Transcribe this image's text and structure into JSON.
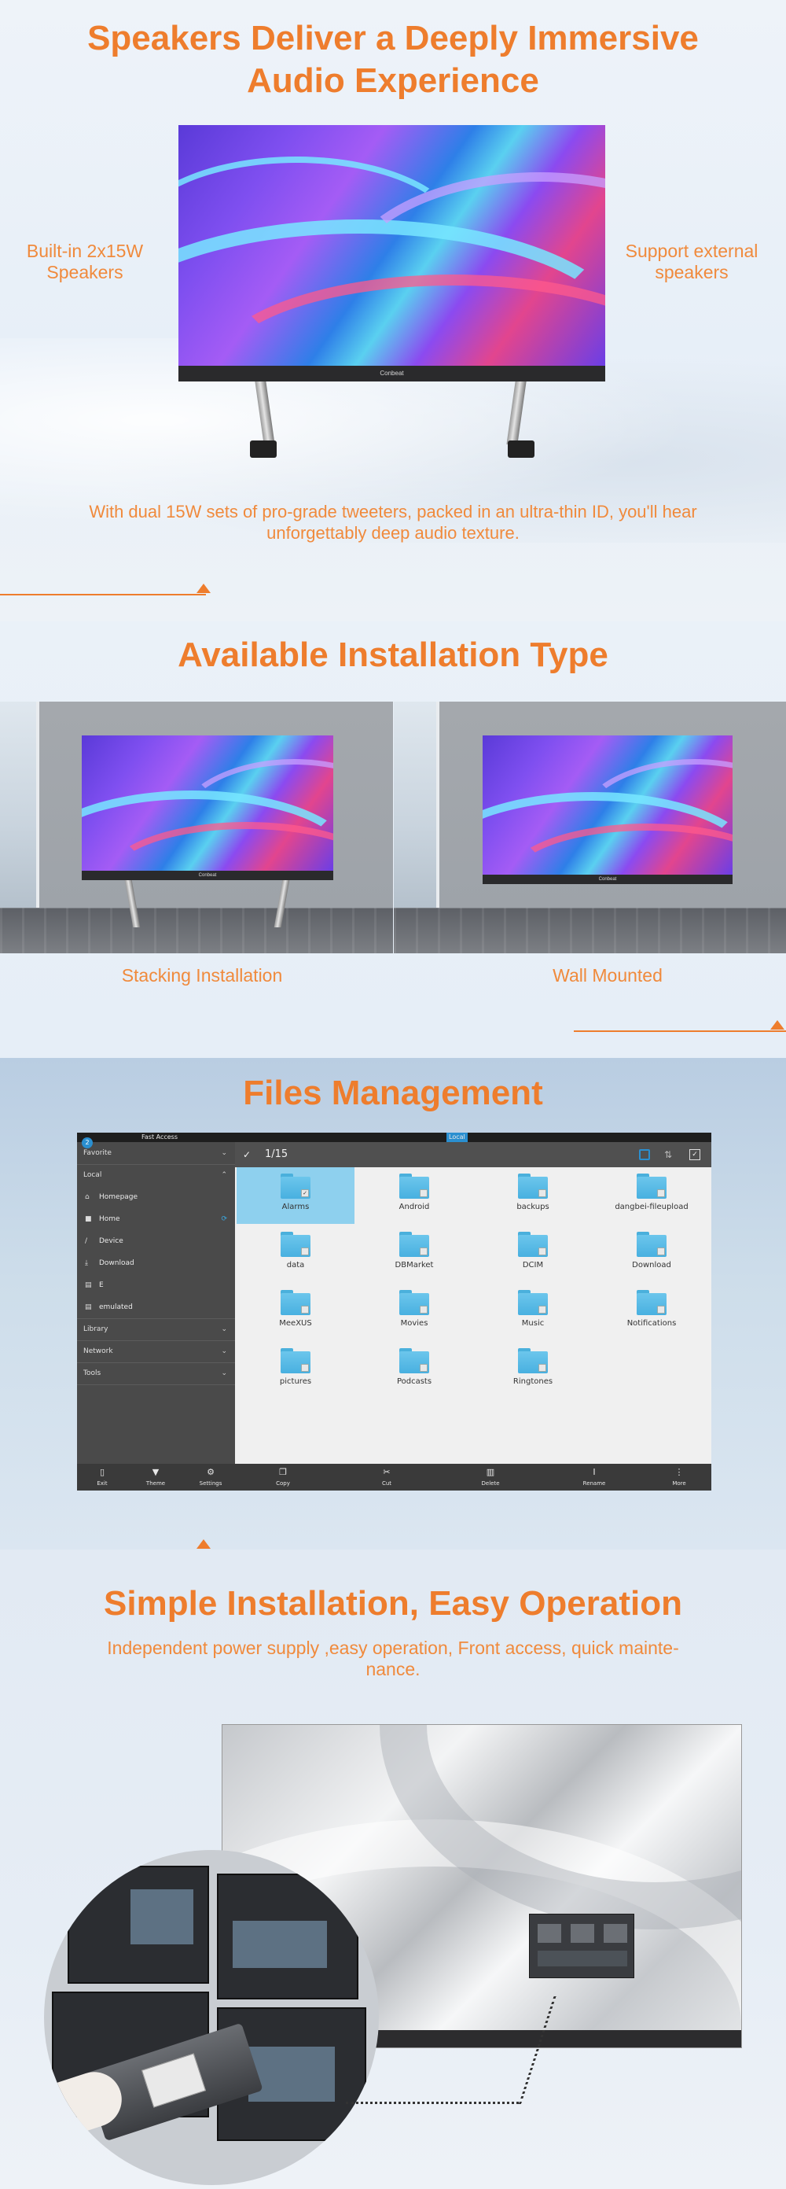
{
  "section_audio": {
    "title_line1": "Speakers Deliver a Deeply Immersive",
    "title_line2": "Audio Experience",
    "left_label": "Built-in 2x15W Speakers",
    "right_label": "Support external speakers",
    "brand": "Conbeat",
    "caption": "With dual 15W sets of pro-grade tweeters, packed in an ultra-thin ID, you'll hear unforgettably deep audio texture."
  },
  "section_install": {
    "title": "Available Installation Type",
    "brand": "Conbeat",
    "items": [
      {
        "label": "Stacking Installation"
      },
      {
        "label": "Wall Mounted"
      }
    ]
  },
  "section_files": {
    "title": "Files Management",
    "topbar": {
      "title": "Fast Access",
      "center": "Local",
      "badge": "2"
    },
    "sidebar": {
      "favorite": "Favorite",
      "local": "Local",
      "items": [
        {
          "label": "Homepage",
          "icon": "homepage-icon",
          "glyph": "⌂"
        },
        {
          "label": "Home",
          "icon": "folder-icon",
          "glyph": "■"
        },
        {
          "label": "Device",
          "icon": "device-icon",
          "glyph": "/"
        },
        {
          "label": "Download",
          "icon": "download-icon",
          "glyph": "⤓"
        },
        {
          "label": "E",
          "icon": "sd-card-icon",
          "glyph": "▤"
        },
        {
          "label": "emulated",
          "icon": "sd-card-icon",
          "glyph": "▤"
        }
      ],
      "library": "Library",
      "network": "Network",
      "tools": "Tools"
    },
    "header": {
      "check": "✓",
      "count": "1/15"
    },
    "folders": [
      {
        "name": "Alarms",
        "selected": true
      },
      {
        "name": "Android",
        "selected": false
      },
      {
        "name": "backups",
        "selected": false
      },
      {
        "name": "dangbei-fileupload",
        "selected": false
      },
      {
        "name": "data",
        "selected": false
      },
      {
        "name": "DBMarket",
        "selected": false
      },
      {
        "name": "DCIM",
        "selected": false
      },
      {
        "name": "Download",
        "selected": false
      },
      {
        "name": "MeeXUS",
        "selected": false
      },
      {
        "name": "Movies",
        "selected": false
      },
      {
        "name": "Music",
        "selected": false
      },
      {
        "name": "Notifications",
        "selected": false
      },
      {
        "name": "pictures",
        "selected": false
      },
      {
        "name": "Podcasts",
        "selected": false
      },
      {
        "name": "Ringtones",
        "selected": false
      }
    ],
    "left_buttons": [
      {
        "label": "Exit",
        "icon": "exit-icon",
        "glyph": "▯"
      },
      {
        "label": "Theme",
        "icon": "theme-icon",
        "glyph": "▼"
      },
      {
        "label": "Settings",
        "icon": "gear-icon",
        "glyph": "⚙"
      }
    ],
    "right_buttons": [
      {
        "label": "Copy",
        "icon": "copy-icon",
        "glyph": "❐"
      },
      {
        "label": "Cut",
        "icon": "scissors-icon",
        "glyph": "✂"
      },
      {
        "label": "Delete",
        "icon": "trash-icon",
        "glyph": "▥"
      },
      {
        "label": "Rename",
        "icon": "text-cursor-icon",
        "glyph": "I"
      },
      {
        "label": "More",
        "icon": "more-icon",
        "glyph": "⋮"
      }
    ]
  },
  "section_operation": {
    "title": "Simple Installation, Easy Operation",
    "subtitle_line1": "Independent power supply ,easy operation, Front access, quick mainte-",
    "subtitle_line2": "nance."
  },
  "colors": {
    "accent": "#ee7d2d",
    "folder_blue": "#5bbde8",
    "selection": "#8ed0ee",
    "sidebar": "#4a4a4a"
  }
}
